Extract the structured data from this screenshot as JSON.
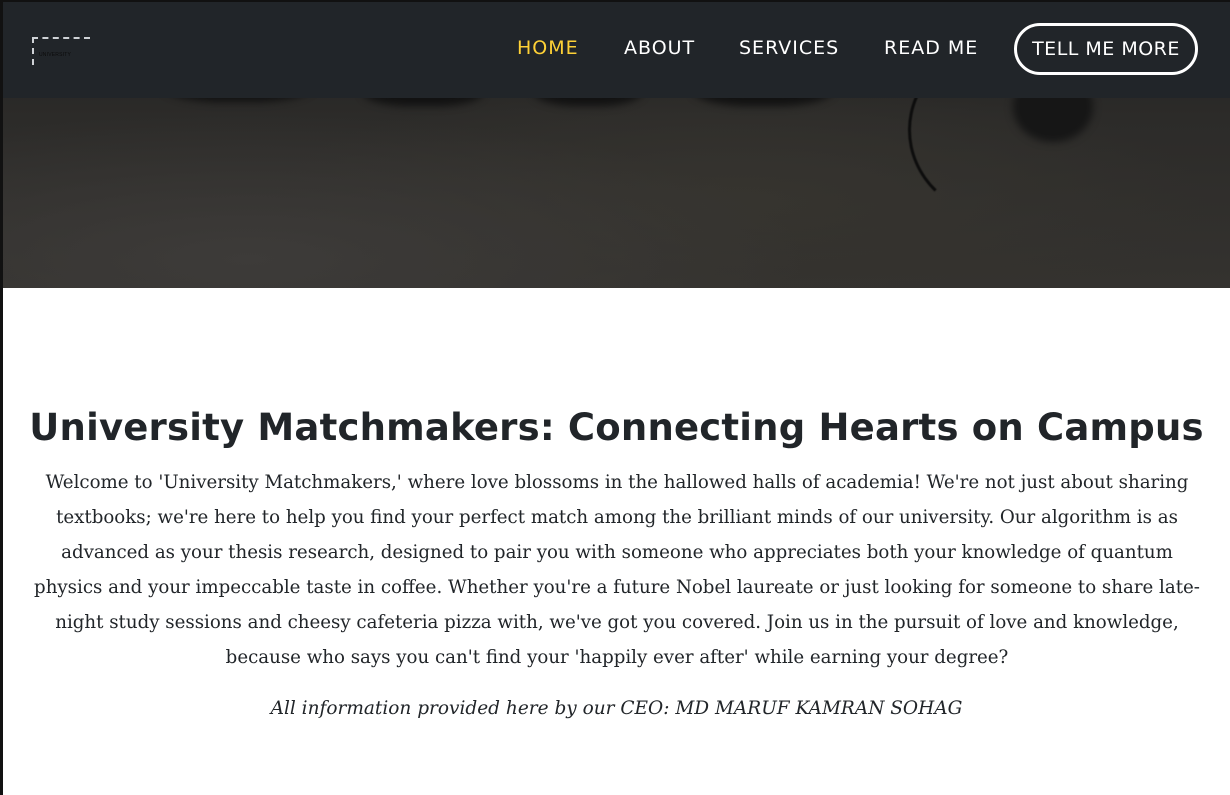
{
  "brand": {
    "logo_text": "UNIVERSITY"
  },
  "nav": {
    "items": [
      {
        "label": "HOME",
        "active": true
      },
      {
        "label": "ABOUT",
        "active": false
      },
      {
        "label": "SERVICES",
        "active": false
      },
      {
        "label": "READ ME",
        "active": false
      }
    ],
    "cta_label": "TELL ME MORE"
  },
  "main": {
    "title": "University Matchmakers: Connecting Hearts on Campus",
    "paragraph": "Welcome to 'University Matchmakers,' where love blossoms in the hallowed halls of academia! We're not just about sharing textbooks; we're here to help you find your perfect match among the brilliant minds of our university. Our algorithm is as advanced as your thesis research, designed to pair you with someone who appreciates both your knowledge of quantum physics and your impeccable taste in coffee. Whether you're a future Nobel laureate or just looking for someone to share late-night study sessions and cheesy cafeteria pizza with, we've got you covered. Join us in the pursuit of love and knowledge, because who says you can't find your 'happily ever after' while earning your degree?",
    "ceo_note": "All information provided here by our CEO: MD MARUF KAMRAN SOHAG"
  },
  "colors": {
    "navbar_bg": "#212529",
    "accent": "#fed136",
    "text": "#212529"
  }
}
